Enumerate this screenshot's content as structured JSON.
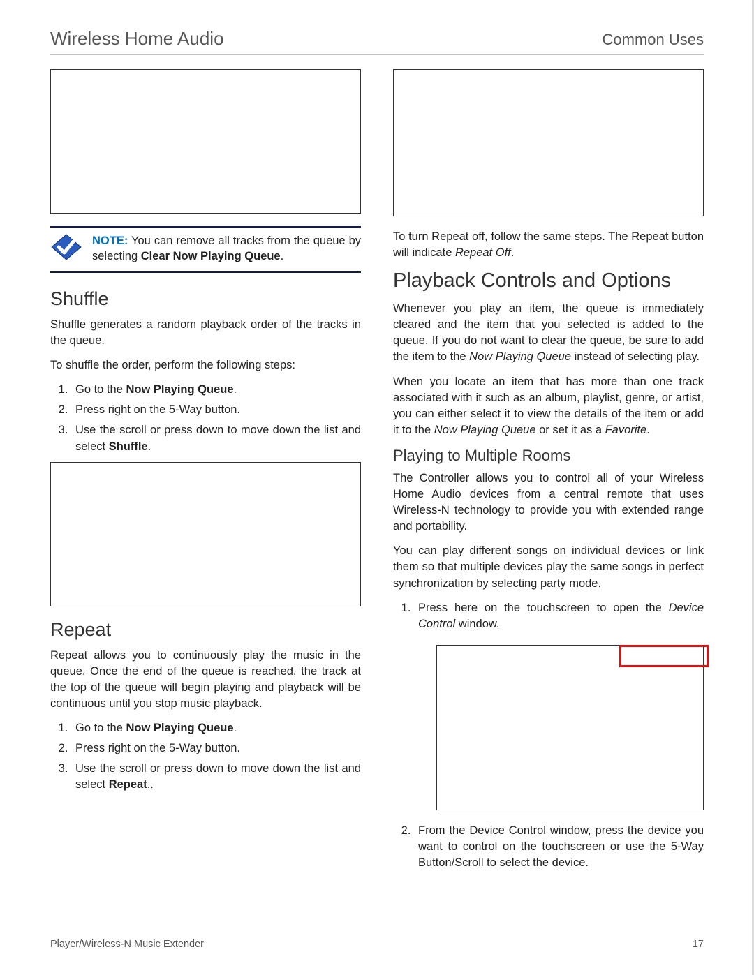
{
  "header": {
    "left": "Wireless Home Audio",
    "right": "Common Uses"
  },
  "note": {
    "label": "NOTE:",
    "before": " You can remove all tracks from the queue by selecting ",
    "bold": "Clear Now Playing Queue",
    "after": "."
  },
  "shuffle": {
    "title": "Shuffle",
    "p1": "Shuffle generates a random playback order of the tracks in the queue.",
    "p2": "To shuffle the order, perform the following steps:",
    "s1a": "Go to the ",
    "s1b": "Now Playing Queue",
    "s1c": ".",
    "s2": "Press right on the 5-Way button.",
    "s3a": "Use the scroll or press down to move down the list and select ",
    "s3b": "Shuffle",
    "s3c": "."
  },
  "repeat": {
    "title": "Repeat",
    "p1": "Repeat allows you to continuously play the music in the queue. Once the end of the queue is reached, the track at the top of the queue will begin playing and playback will be continuous until you stop music playback.",
    "s1a": "Go to the ",
    "s1b": "Now Playing Queue",
    "s1c": ".",
    "s2": "Press right on the 5-Way button.",
    "s3a": "Use the scroll or press down to move down the list and select ",
    "s3b": "Repeat",
    "s3c": ".."
  },
  "repeat_off": {
    "a": "To turn Repeat off, follow the same steps. The Repeat button will indicate ",
    "it": "Repeat Off",
    "b": "."
  },
  "playback": {
    "title": "Playback Controls and Options",
    "p1a": "Whenever you play an item, the queue is immediately cleared and the item that you selected is added to the queue. If you do not want to clear the queue, be sure to add the item to the ",
    "p1it": "Now Playing Queue",
    "p1b": " instead of selecting play.",
    "p2a": "When you locate an item that has more than one track associated with it such as an album, playlist, genre, or artist, you can either select it to view the details of the item or add it to the ",
    "p2it1": "Now Playing Queue",
    "p2mid": " or set it as a ",
    "p2it2": "Favorite",
    "p2b": "."
  },
  "rooms": {
    "title": "Playing to Multiple Rooms",
    "p1": "The Controller allows you to control all of your Wireless Home Audio devices from a central remote that uses Wireless-N technology to provide you with extended range and portability.",
    "p2": "You can play different songs on individual devices or link them so that multiple devices play the same songs in perfect synchronization by selecting party mode.",
    "s1a": "Press here on the touchscreen to open the ",
    "s1it": "Device Control",
    "s1b": " window.",
    "s2": "From the Device Control window, press the device you want to control on the touchscreen or use the 5-Way Button/Scroll to select the device."
  },
  "footer": {
    "left": "Player/Wireless-N Music Extender",
    "right": "17"
  }
}
